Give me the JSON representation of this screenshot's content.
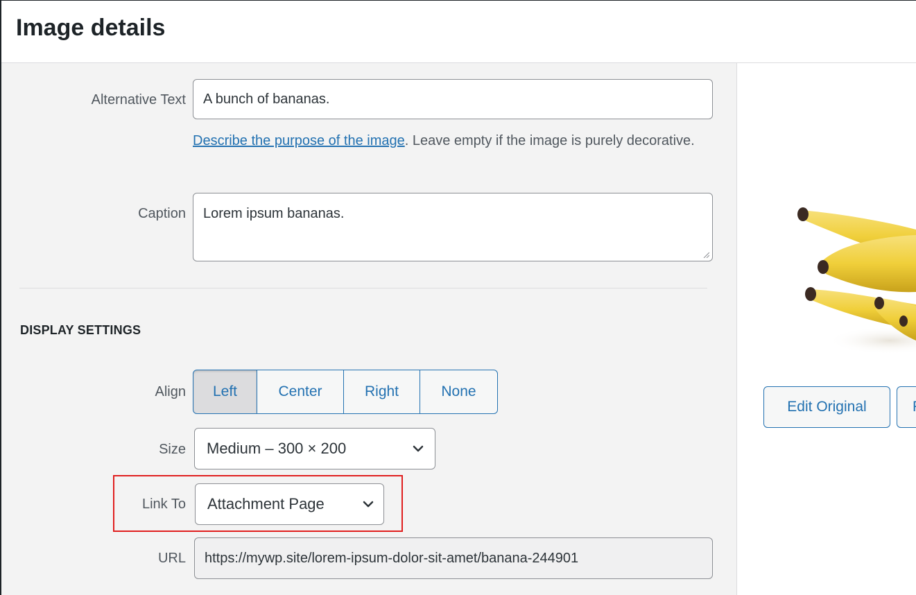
{
  "header": {
    "title": "Image details"
  },
  "form": {
    "alt_label": "Alternative Text",
    "alt_value": "A bunch of bananas.",
    "help_link": "Describe the purpose of the image",
    "help_text": ". Leave empty if the image is purely decorative.",
    "caption_label": "Caption",
    "caption_value": "Lorem ipsum bananas."
  },
  "display": {
    "section_title": "DISPLAY SETTINGS",
    "align_label": "Align",
    "align_options": [
      "Left",
      "Center",
      "Right",
      "None"
    ],
    "align_selected": "Left",
    "size_label": "Size",
    "size_value": "Medium – 300 × 200",
    "link_label": "Link To",
    "link_value": "Attachment Page",
    "url_label": "URL",
    "url_value": "https://mywp.site/lorem-ipsum-dolor-sit-amet/banana-244901"
  },
  "preview": {
    "edit_original_label": "Edit Original",
    "second_button_label": "R"
  },
  "colors": {
    "accent": "#2271b1",
    "highlight": "#e01e1e",
    "panel": "#f3f3f3"
  }
}
